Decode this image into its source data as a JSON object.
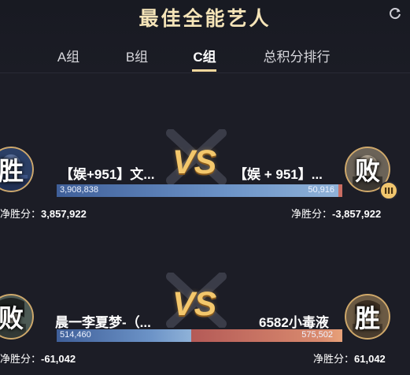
{
  "header": {
    "title": "最佳全能艺人",
    "refresh_icon": "refresh-icon"
  },
  "tabs": [
    {
      "label": "A组",
      "active": false
    },
    {
      "label": "B组",
      "active": false
    },
    {
      "label": "C组",
      "active": true
    },
    {
      "label": "总积分排行",
      "active": false
    }
  ],
  "colors": {
    "accent_gold": "#f3d79c",
    "bar_blue": "#6f95c6",
    "bar_red": "#c96d63",
    "background": "#1c1d26"
  },
  "matches": [
    {
      "vs_label": "VS",
      "left": {
        "name": "【娱+951】文...",
        "result": "胜",
        "score": "3,908,838",
        "net_label": "净胜分：",
        "net_value": "3,857,922"
      },
      "right": {
        "name": "【娱 + 951】...",
        "result": "败",
        "score": "50,916",
        "net_label": "净胜分：",
        "net_value": "-3,857,922",
        "badge_icon": "live-icon"
      },
      "left_share": 0.987
    },
    {
      "vs_label": "VS",
      "left": {
        "name": "晨一李夏梦-（...",
        "result": "败",
        "score": "514,460",
        "net_label": "净胜分：",
        "net_value": "-61,042"
      },
      "right": {
        "name": "6582小毒液",
        "result": "胜",
        "score": "575,502",
        "net_label": "净胜分：",
        "net_value": "61,042"
      },
      "left_share": 0.472
    }
  ]
}
